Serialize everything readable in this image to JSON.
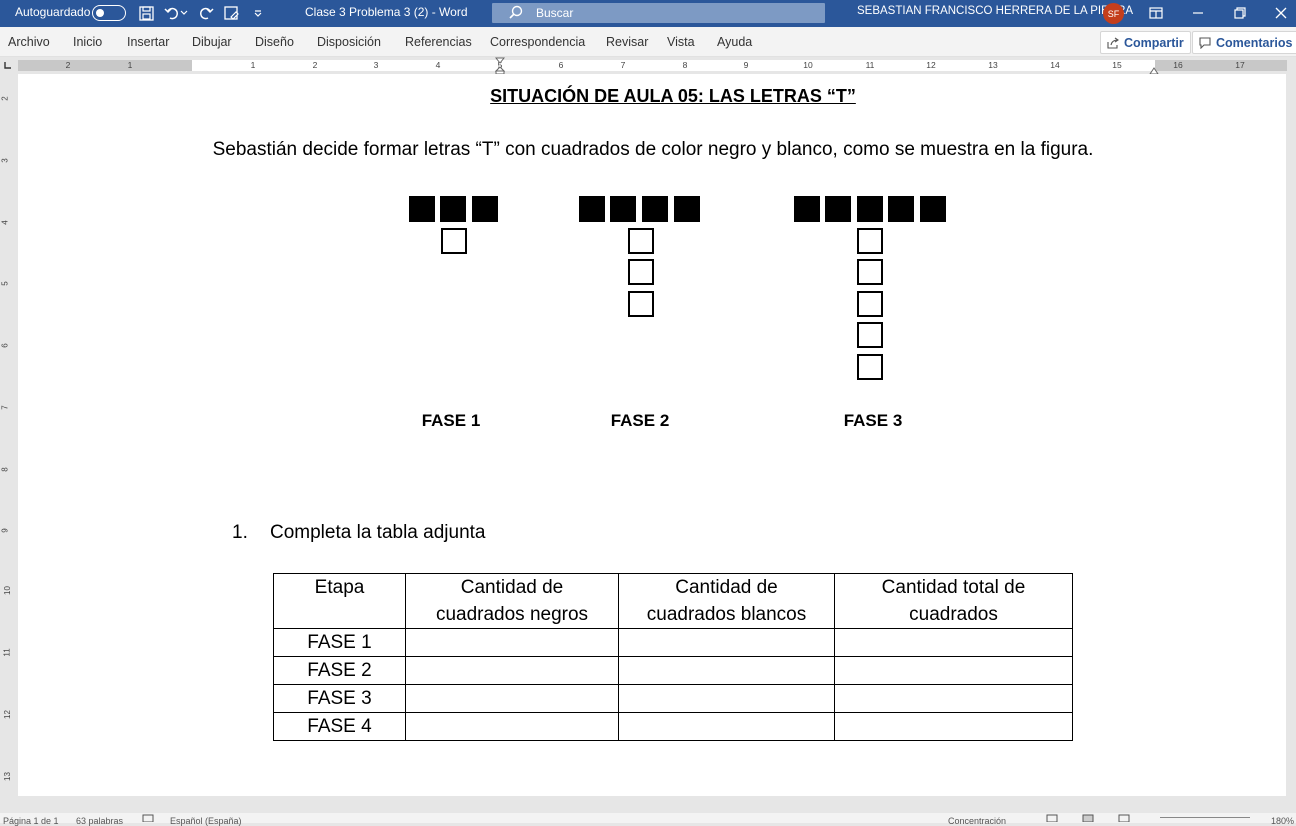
{
  "titlebar": {
    "autosave_label": "Autoguardado",
    "doc_title": "Clase 3 Problema 3 (2)  -  Word",
    "search_placeholder": "Buscar",
    "user_name": "SEBASTIAN FRANCISCO HERRERA DE LA PIEDRA",
    "user_initials": "SF",
    "icons": [
      "save-icon",
      "undo-icon",
      "redo-icon",
      "touch-mode-icon",
      "customize-qat-icon",
      "ribbon-display-icon",
      "minimize-icon",
      "restore-icon",
      "close-icon"
    ]
  },
  "menu": {
    "items": [
      "Archivo",
      "Inicio",
      "Insertar",
      "Dibujar",
      "Diseño",
      "Disposición",
      "Referencias",
      "Correspondencia",
      "Revisar",
      "Vista",
      "Ayuda"
    ],
    "share_label": "Compartir",
    "comments_label": "Comentarios"
  },
  "ruler": {
    "h_numbers": [
      "2",
      "1",
      "1",
      "2",
      "3",
      "4",
      "5",
      "6",
      "7",
      "8",
      "9",
      "10",
      "11",
      "12",
      "13",
      "14",
      "15",
      "16",
      "17"
    ],
    "v_numbers": [
      "2",
      "3",
      "4",
      "5",
      "6",
      "7",
      "8",
      "9",
      "10",
      "11",
      "12",
      "13"
    ]
  },
  "document": {
    "title": "SITUACIÓN DE AULA 05: LAS LETRAS “T”",
    "intro": "Sebastián decide formar letras “T” con cuadrados de color negro y blanco, como se muestra en la figura.",
    "figures": [
      {
        "label": "FASE 1",
        "black": 3,
        "white": 1
      },
      {
        "label": "FASE 2",
        "black": 4,
        "white": 3
      },
      {
        "label": "FASE 3",
        "black": 5,
        "white": 5
      }
    ],
    "question_number": "1.",
    "question_text": "Completa la tabla adjunta",
    "table": {
      "headers": [
        [
          "Etapa"
        ],
        [
          "Cantidad de",
          "cuadrados negros"
        ],
        [
          "Cantidad de",
          "cuadrados blancos"
        ],
        [
          "Cantidad total de",
          "cuadrados"
        ]
      ],
      "rows": [
        [
          "FASE 1",
          "",
          "",
          ""
        ],
        [
          "FASE 2",
          "",
          "",
          ""
        ],
        [
          "FASE 3",
          "",
          "",
          ""
        ],
        [
          "FASE 4",
          "",
          "",
          ""
        ]
      ]
    }
  },
  "statusbar": {
    "page": "Página 1 de 1",
    "words": "63 palabras",
    "language": "Español (España)",
    "focus": "Concentración",
    "zoom": "180%"
  },
  "colors": {
    "titlebar": "#2b579a",
    "avatar": "#c43e1c",
    "accent": "#2b579a"
  }
}
